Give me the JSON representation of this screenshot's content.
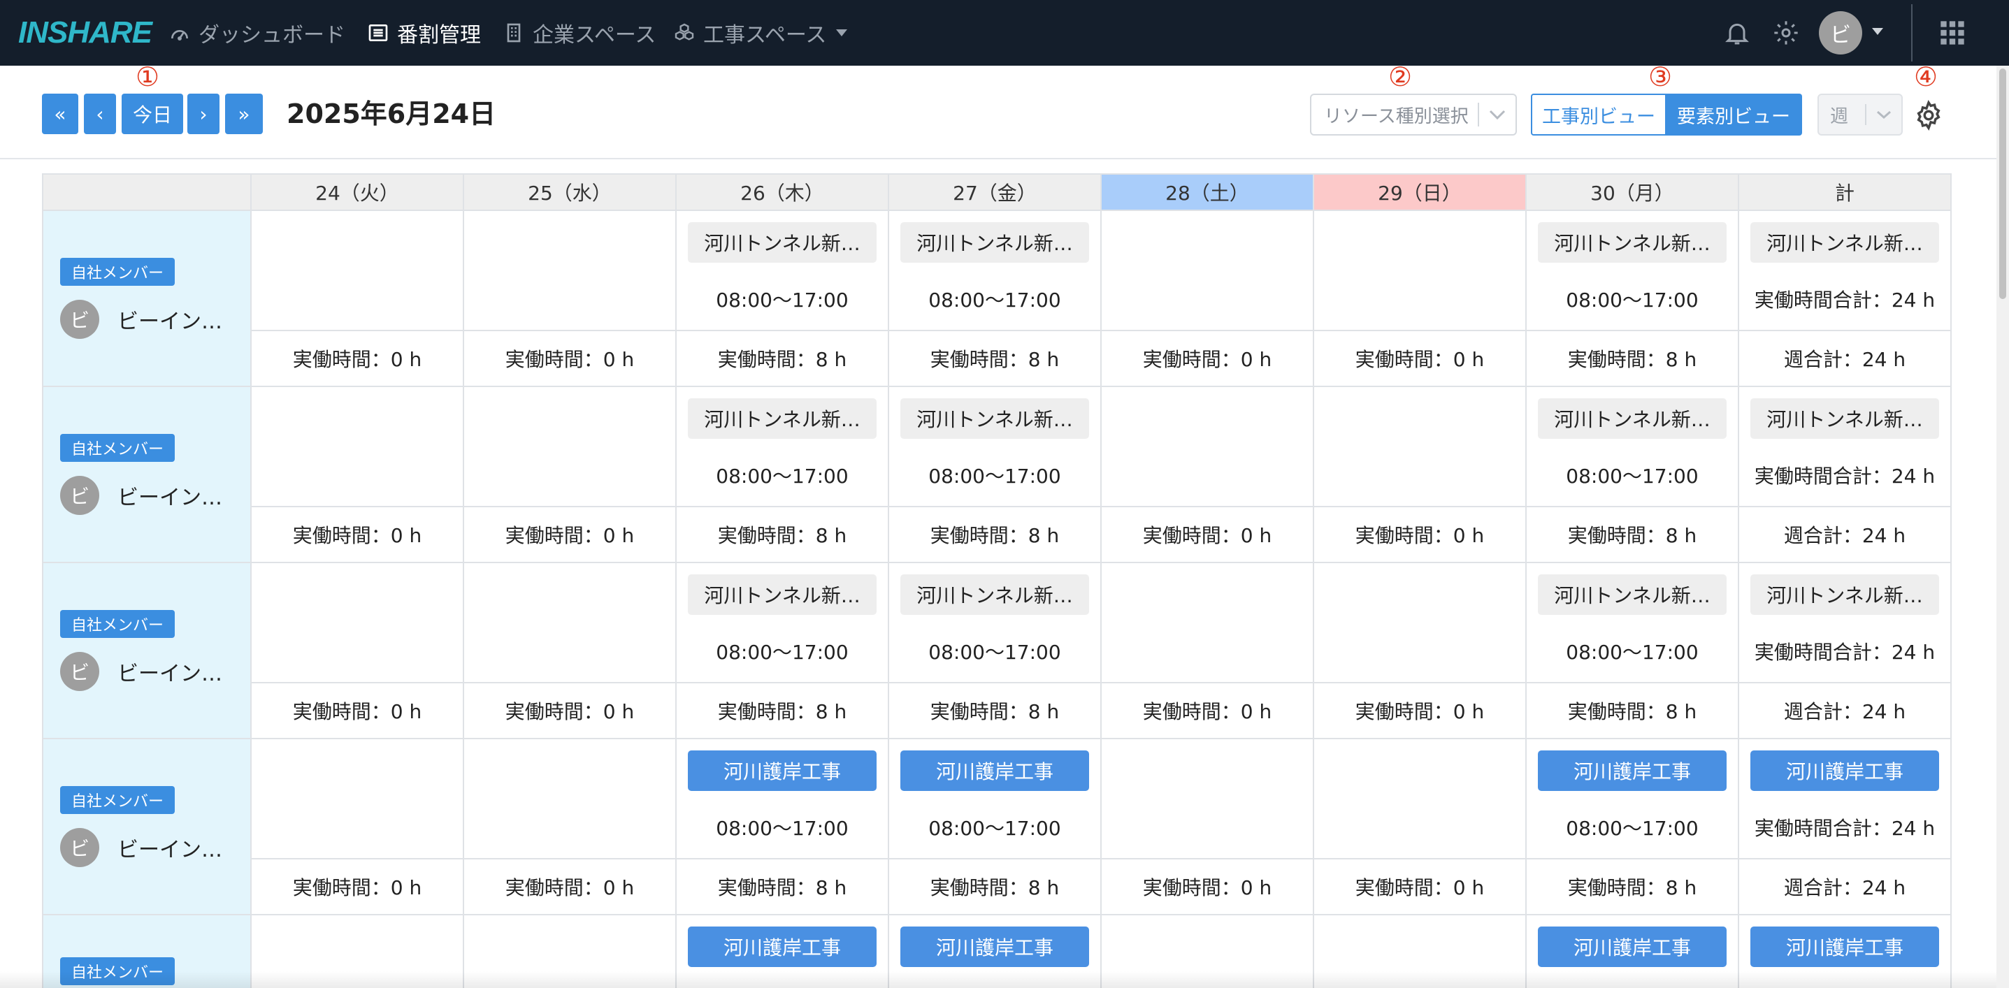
{
  "app": {
    "logo": "INSHARE",
    "nav": [
      {
        "label": "ダッシュボード",
        "icon": "dashboard-gauge-icon"
      },
      {
        "label": "番割管理",
        "icon": "list-icon"
      },
      {
        "label": "企業スペース",
        "icon": "building-icon"
      },
      {
        "label": "工事スペース",
        "icon": "cubes-icon"
      }
    ],
    "avatar_initial": "ビ"
  },
  "annotations": [
    "①",
    "②",
    "③",
    "④"
  ],
  "toolbar": {
    "first_label": "«",
    "prev_label": "‹",
    "today_label": "今日",
    "next_label": "›",
    "last_label": "»",
    "current_date": "2025年6月24日",
    "resource_placeholder": "リソース種別選択",
    "view_by_project": "工事別ビュー",
    "view_by_element": "要素別ビュー",
    "period": "週"
  },
  "table": {
    "columns": [
      "",
      "24（火）",
      "25（水）",
      "26（木）",
      "27（金）",
      "28（土）",
      "29（日）",
      "30（月）",
      "計"
    ],
    "rows": [
      {
        "badge": "自社メンバー",
        "initial": "ビ",
        "name": "ビーイン…",
        "top": [
          null,
          null,
          {
            "chip": "河川トンネル新…",
            "time": "08:00〜17:00",
            "style": "gray"
          },
          {
            "chip": "河川トンネル新…",
            "time": "08:00〜17:00",
            "style": "gray"
          },
          null,
          null,
          {
            "chip": "河川トンネル新…",
            "time": "08:00〜17:00",
            "style": "gray"
          },
          {
            "chip": "河川トンネル新…",
            "time": "実働時間合計：24 h",
            "style": "gray"
          }
        ],
        "bottom": [
          "実働時間：0 h",
          "実働時間：0 h",
          "実働時間：8 h",
          "実働時間：8 h",
          "実働時間：0 h",
          "実働時間：0 h",
          "実働時間：8 h",
          "週合計：24 h"
        ]
      },
      {
        "badge": "自社メンバー",
        "initial": "ビ",
        "name": "ビーイン…",
        "top": [
          null,
          null,
          {
            "chip": "河川トンネル新…",
            "time": "08:00〜17:00",
            "style": "gray"
          },
          {
            "chip": "河川トンネル新…",
            "time": "08:00〜17:00",
            "style": "gray"
          },
          null,
          null,
          {
            "chip": "河川トンネル新…",
            "time": "08:00〜17:00",
            "style": "gray"
          },
          {
            "chip": "河川トンネル新…",
            "time": "実働時間合計：24 h",
            "style": "gray"
          }
        ],
        "bottom": [
          "実働時間：0 h",
          "実働時間：0 h",
          "実働時間：8 h",
          "実働時間：8 h",
          "実働時間：0 h",
          "実働時間：0 h",
          "実働時間：8 h",
          "週合計：24 h"
        ]
      },
      {
        "badge": "自社メンバー",
        "initial": "ビ",
        "name": "ビーイン…",
        "top": [
          null,
          null,
          {
            "chip": "河川トンネル新…",
            "time": "08:00〜17:00",
            "style": "gray"
          },
          {
            "chip": "河川トンネル新…",
            "time": "08:00〜17:00",
            "style": "gray"
          },
          null,
          null,
          {
            "chip": "河川トンネル新…",
            "time": "08:00〜17:00",
            "style": "gray"
          },
          {
            "chip": "河川トンネル新…",
            "time": "実働時間合計：24 h",
            "style": "gray"
          }
        ],
        "bottom": [
          "実働時間：0 h",
          "実働時間：0 h",
          "実働時間：8 h",
          "実働時間：8 h",
          "実働時間：0 h",
          "実働時間：0 h",
          "実働時間：8 h",
          "週合計：24 h"
        ]
      },
      {
        "badge": "自社メンバー",
        "initial": "ビ",
        "name": "ビーイン…",
        "top": [
          null,
          null,
          {
            "chip": "河川護岸工事",
            "time": "08:00〜17:00",
            "style": "blue"
          },
          {
            "chip": "河川護岸工事",
            "time": "08:00〜17:00",
            "style": "blue"
          },
          null,
          null,
          {
            "chip": "河川護岸工事",
            "time": "08:00〜17:00",
            "style": "blue"
          },
          {
            "chip": "河川護岸工事",
            "time": "実働時間合計：24 h",
            "style": "blue"
          }
        ],
        "bottom": [
          "実働時間：0 h",
          "実働時間：0 h",
          "実働時間：8 h",
          "実働時間：8 h",
          "実働時間：0 h",
          "実働時間：0 h",
          "実働時間：8 h",
          "週合計：24 h"
        ]
      },
      {
        "badge": "自社メンバー",
        "initial": "",
        "name": "",
        "top": [
          null,
          null,
          {
            "chip": "河川護岸工事",
            "time": "",
            "style": "blue"
          },
          {
            "chip": "河川護岸工事",
            "time": "",
            "style": "blue"
          },
          null,
          null,
          {
            "chip": "河川護岸工事",
            "time": "",
            "style": "blue"
          },
          {
            "chip": "河川護岸工事",
            "time": "",
            "style": "blue"
          }
        ],
        "bottom": null
      }
    ]
  },
  "colors": {
    "nav_bg": "#141e2b",
    "logo": "#2fb7c9",
    "primary": "#3b8ee0",
    "saturday_header": "#a9cdfa",
    "sunday_header": "#fcc9c9",
    "member_cell": "#e3f5fc",
    "annotation": "#e03a20"
  }
}
